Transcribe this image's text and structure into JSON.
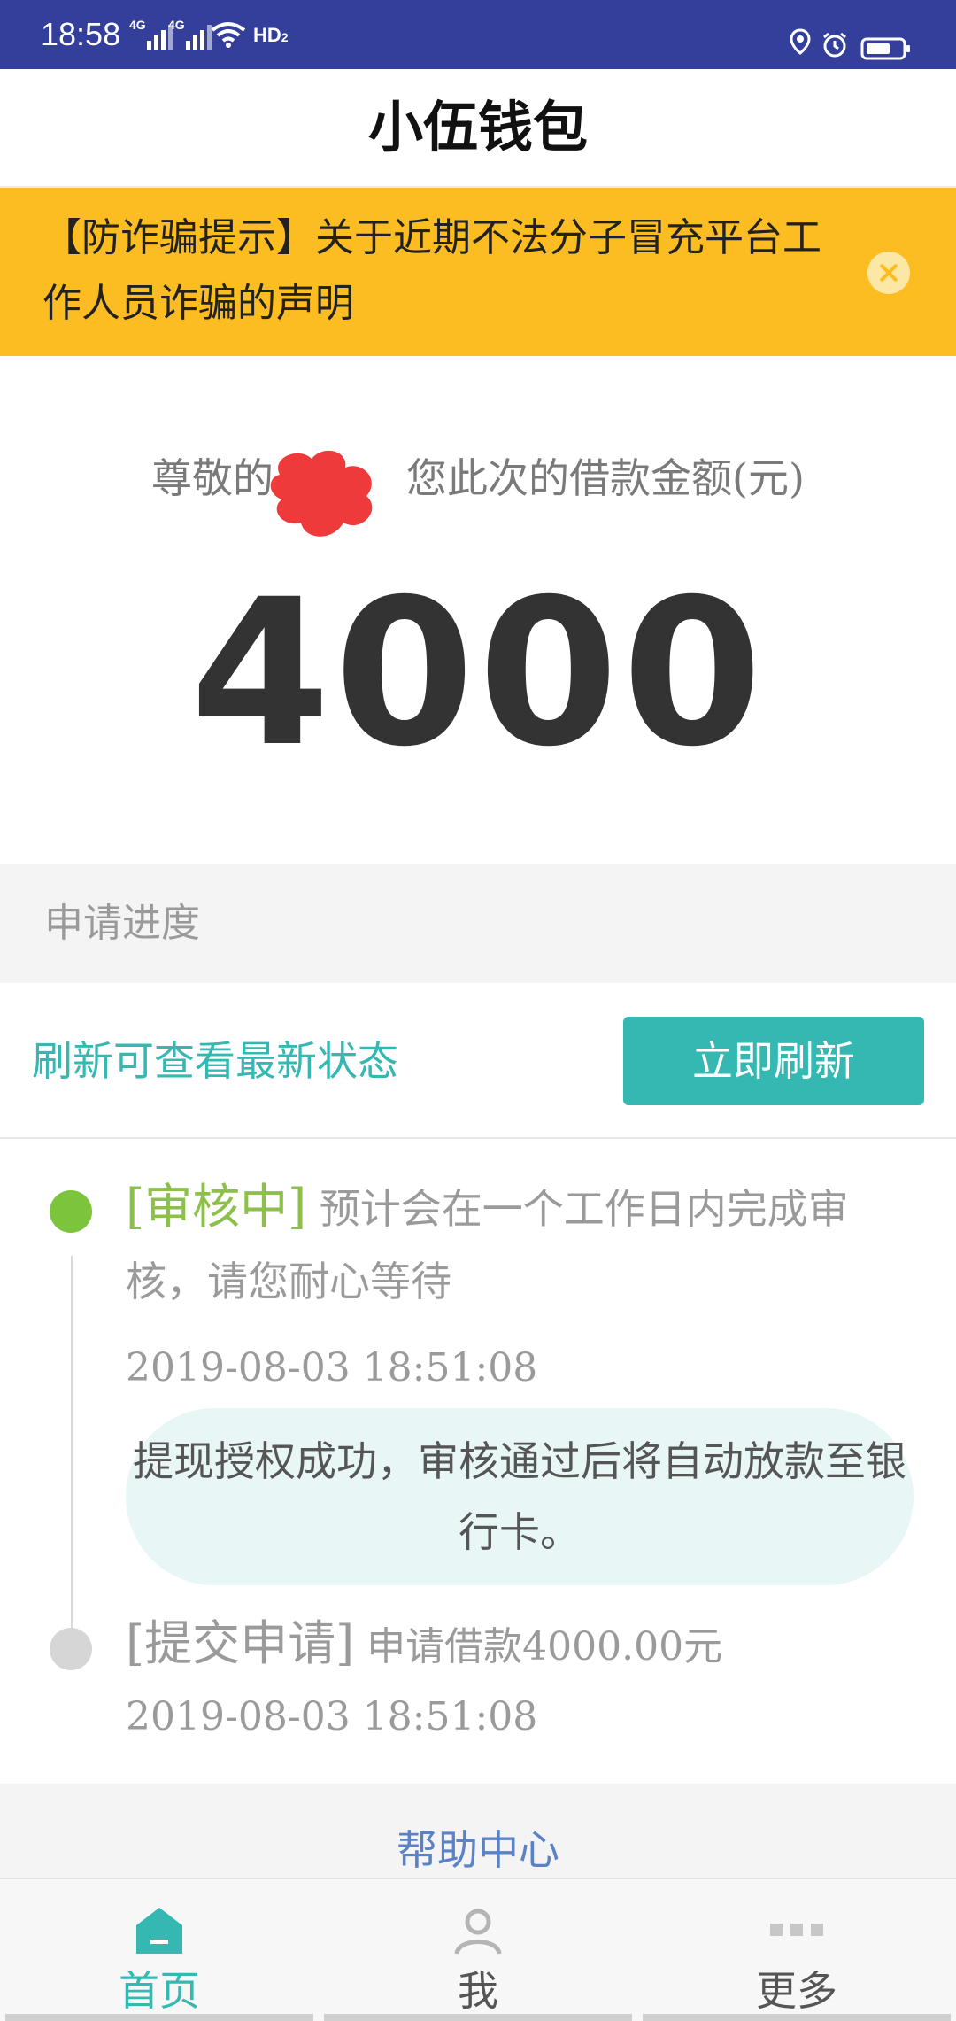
{
  "status_bar": {
    "time": "18:58",
    "signal1_label": "4G",
    "signal2_label": "4G",
    "hd_label": "HD",
    "hd_sub": "2",
    "background": "#343f9c"
  },
  "header": {
    "title": "小伍钱包"
  },
  "notice": {
    "text": "【防诈骗提示】关于近期不法分子冒充平台工作人员诈骗的声明",
    "background": "#fbbd21"
  },
  "loan": {
    "greeting_prefix": "尊敬的",
    "greeting_suffix": "您此次的借款金额(元)",
    "amount": "4000"
  },
  "progress": {
    "section_title": "申请进度",
    "refresh_hint": "刷新可查看最新状态",
    "refresh_button": "立即刷新",
    "accent": "#35b8b2",
    "steps": [
      {
        "status": "[审核中]",
        "description": "预计会在一个工作日内完成审核，请您耐心等待",
        "timestamp": "2019-08-03 18:51:08",
        "message": "提现授权成功，审核通过后将自动放款至银行卡。"
      },
      {
        "status": "[提交申请]",
        "description": "申请借款4000.00元",
        "timestamp": "2019-08-03 18:51:08"
      }
    ]
  },
  "help": {
    "label": "帮助中心"
  },
  "bottom_nav": {
    "items": [
      {
        "label": "首页",
        "icon": "home-icon",
        "active": true
      },
      {
        "label": "我",
        "icon": "user-icon",
        "active": false
      },
      {
        "label": "更多",
        "icon": "more-icon",
        "active": false
      }
    ]
  }
}
